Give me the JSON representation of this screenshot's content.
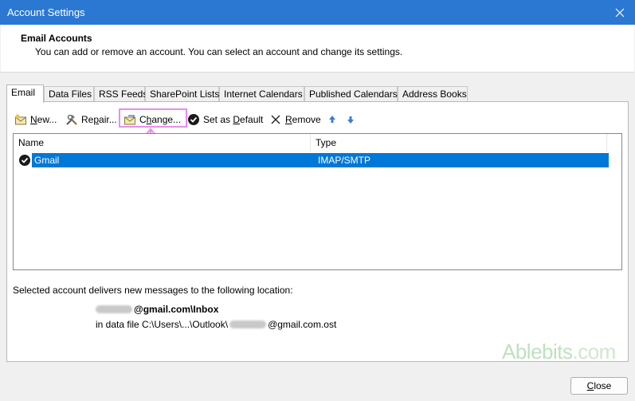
{
  "window": {
    "title": "Account Settings"
  },
  "header": {
    "title": "Email Accounts",
    "description": "You can add or remove an account. You can select an account and change its settings."
  },
  "tabs": [
    {
      "label": "Email"
    },
    {
      "label": "Data Files"
    },
    {
      "label": "RSS Feeds"
    },
    {
      "label": "SharePoint Lists"
    },
    {
      "label": "Internet Calendars"
    },
    {
      "label": "Published Calendars"
    },
    {
      "label": "Address Books"
    }
  ],
  "toolbar": {
    "new_pre": "",
    "new_u": "N",
    "new_post": "ew...",
    "repair_pre": "Re",
    "repair_u": "p",
    "repair_post": "air...",
    "change_pre": "C",
    "change_u": "h",
    "change_post": "ange...",
    "default_pre": "Set as ",
    "default_u": "D",
    "default_post": "efault",
    "remove_pre": "",
    "remove_u": "R",
    "remove_post": "emove"
  },
  "list": {
    "columns": {
      "name": "Name",
      "type": "Type"
    },
    "rows": [
      {
        "name": "Gmail",
        "type": "IMAP/SMTP"
      }
    ]
  },
  "delivery": {
    "label": "Selected account delivers new messages to the following location:",
    "inbox_suffix": "@gmail.com\\Inbox",
    "datafile_prefix": "in data file C:\\Users\\...\\Outlook\\",
    "datafile_suffix": "@gmail.com.ost"
  },
  "brand": {
    "name": "Ablebits",
    "domain": ".com"
  },
  "buttons": {
    "close_u": "C",
    "close_post": "lose"
  },
  "colors": {
    "titlebar": "#2b78d3",
    "selection": "#0078d7",
    "highlight": "#e98cf0"
  }
}
